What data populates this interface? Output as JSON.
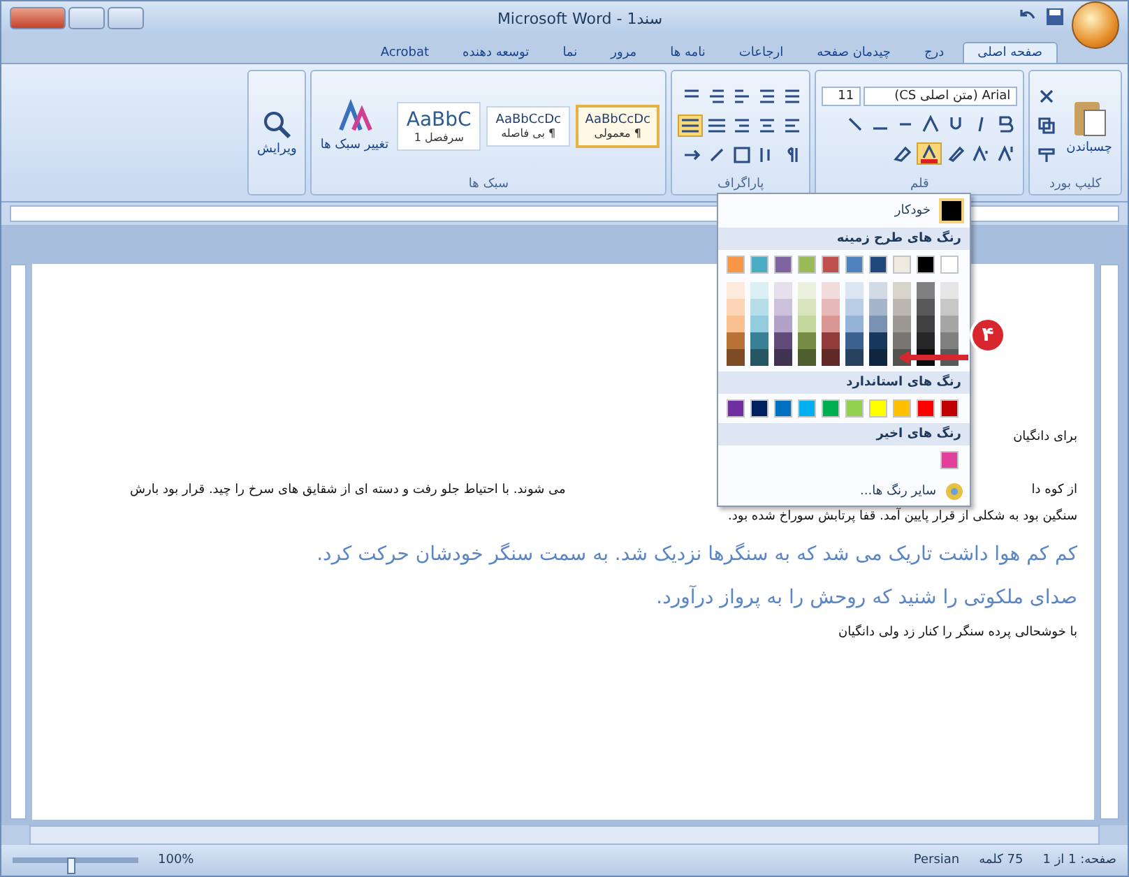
{
  "window": {
    "title": "Microsoft Word - سند1"
  },
  "tabs": [
    {
      "label": "صفحه اصلی",
      "selected": true
    },
    {
      "label": "درج",
      "selected": false
    },
    {
      "label": "چیدمان صفحه",
      "selected": false
    },
    {
      "label": "ارجاعات",
      "selected": false
    },
    {
      "label": "نامه ها",
      "selected": false
    },
    {
      "label": "مرور",
      "selected": false
    },
    {
      "label": "نما",
      "selected": false
    },
    {
      "label": "توسعه دهنده",
      "selected": false
    },
    {
      "label": "Acrobat",
      "selected": false
    }
  ],
  "ribbon": {
    "paste": "چسباندن",
    "font_name": "Arial (متن اصلی CS)",
    "font_size": "11",
    "styles": [
      {
        "preview": "AaBbCcDc",
        "label": "¶ معمولی",
        "selected": true
      },
      {
        "preview": "AaBbCcDc",
        "label": "¶ بی فاصله",
        "selected": false
      },
      {
        "preview": "AaBbC",
        "label": "سرفصل 1",
        "selected": false
      }
    ],
    "change_styles": "تغییر سبک ها",
    "editing": "ویرایش",
    "group_labels": [
      "کلیپ بورد",
      "قلم",
      "پاراگراف",
      "سبک ها"
    ]
  },
  "color_menu": {
    "automatic": "خودکار",
    "theme_header": "رنگ های طرح زمینه",
    "theme_colors": [
      {
        "color": "#ffffff"
      },
      {
        "color": "#000000"
      },
      {
        "color": "#eeece1"
      },
      {
        "color": "#1f497d"
      },
      {
        "color": "#4f81bd"
      },
      {
        "color": "#c0504d"
      },
      {
        "color": "#9bbb59"
      },
      {
        "color": "#8064a2"
      },
      {
        "color": "#4bacc6"
      },
      {
        "color": "#f79646"
      }
    ],
    "standard_header": "رنگ های استاندارد",
    "standard_colors": [
      {
        "color": "#c00000"
      },
      {
        "color": "#ff0000"
      },
      {
        "color": "#ffc000"
      },
      {
        "color": "#ffff00"
      },
      {
        "color": "#92d050"
      },
      {
        "color": "#00b050"
      },
      {
        "color": "#00b0f0"
      },
      {
        "color": "#0070c0"
      },
      {
        "color": "#002060"
      },
      {
        "color": "#7030a0"
      }
    ],
    "recent_header": "رنگ های اخیر",
    "recent_colors": [
      {
        "color": "#e0409a"
      }
    ],
    "more": "سایر رنگ ها..."
  },
  "callout": {
    "label": "۴"
  },
  "document": {
    "lines": [
      {
        "kind": "plain",
        "text": "برای دانگیان"
      },
      {
        "kind": "split",
        "right": "از کوه دا",
        "left": "می شوند. با احتیاط جلو رفت و دسته ای از شقایق های سرخ را چید. قرار بود بارش"
      },
      {
        "kind": "plain",
        "text": "سنگین بود به شکلی از قرار پایین آمد. قفا پرتابش سوراخ شده بود."
      },
      {
        "kind": "blue",
        "text": "کم کم هوا داشت تاریک می شد که به سنگرها نزدیک شد. به سمت سنگر خودشان حرکت کرد."
      },
      {
        "kind": "blue",
        "text": "صدای ملکوتی را شنید که روحش را به پرواز درآورد."
      },
      {
        "kind": "plain",
        "text": "با خوشحالی پرده سنگر را کنار زد ولی دانگیان"
      }
    ]
  },
  "status_bar": {
    "page": "صفحه: 1 از 1",
    "words": "75 کلمه",
    "language": "Persian",
    "zoom": "100%",
    "zoom_slider": {
      "level": 0.5
    }
  }
}
